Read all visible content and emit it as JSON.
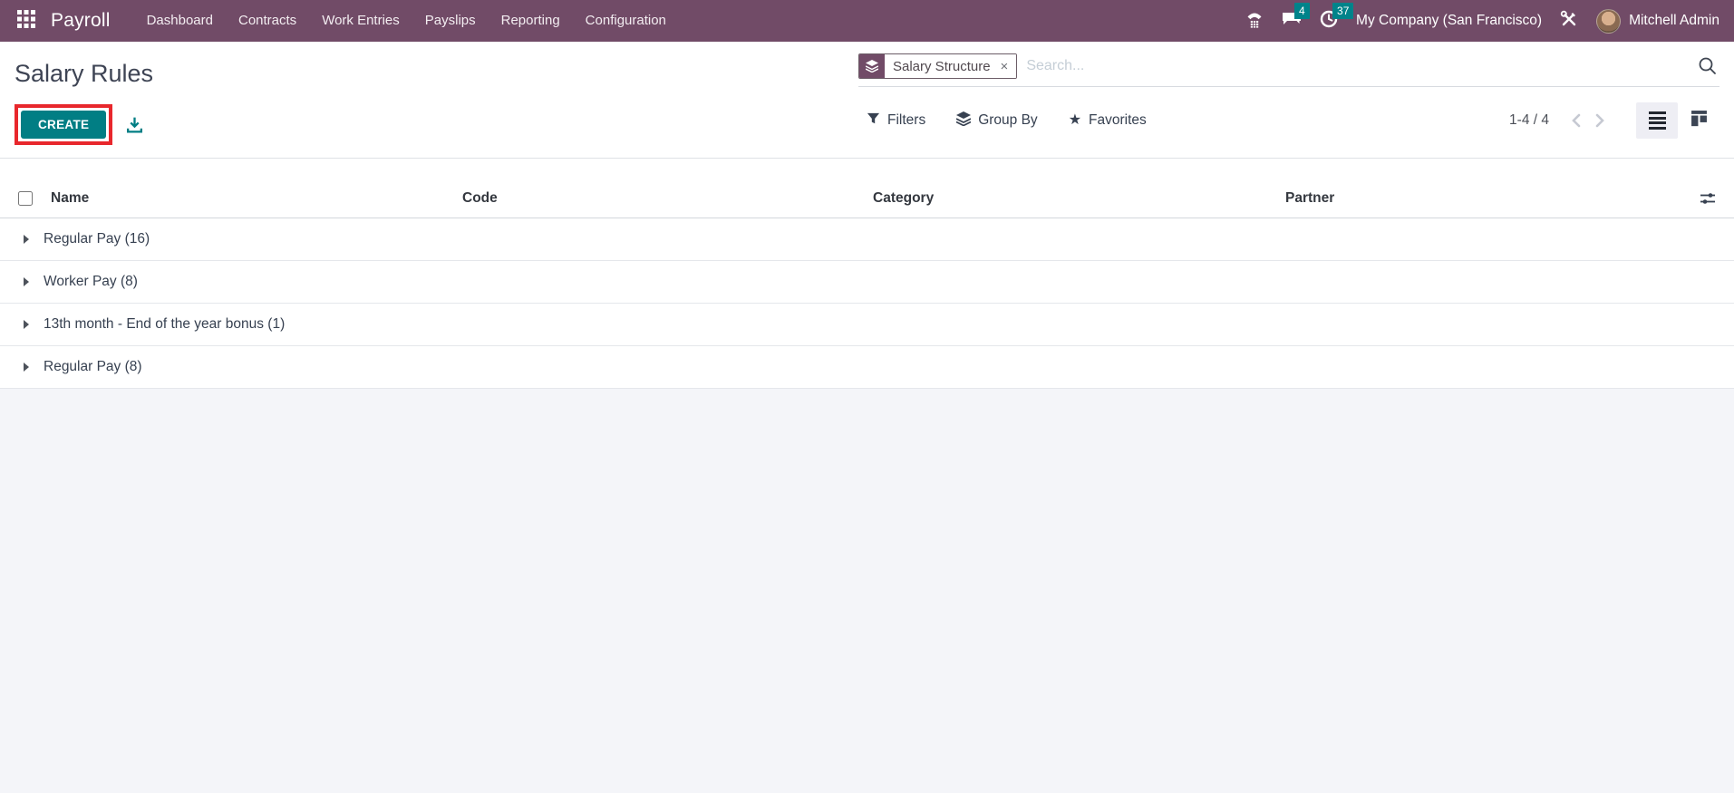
{
  "navbar": {
    "app_name": "Payroll",
    "menu_items": [
      "Dashboard",
      "Contracts",
      "Work Entries",
      "Payslips",
      "Reporting",
      "Configuration"
    ],
    "messages_badge": "4",
    "activities_badge": "37",
    "company_name": "My Company (San Francisco)",
    "user_name": "Mitchell Admin",
    "colors": {
      "background": "#714B67",
      "badge": "#00838A"
    }
  },
  "page": {
    "title": "Salary Rules"
  },
  "toolbar": {
    "create_label": "CREATE",
    "filters_label": "Filters",
    "group_by_label": "Group By",
    "favorites_label": "Favorites",
    "pager_text": "1-4 / 4",
    "accent_color": "#017E84",
    "highlight_color": "#E8272C"
  },
  "search": {
    "facet_label": "Salary Structure",
    "facet_remove": "×",
    "placeholder": "Search..."
  },
  "table": {
    "columns": [
      "Name",
      "Code",
      "Category",
      "Partner"
    ],
    "groups": [
      {
        "text": "Regular Pay (16)"
      },
      {
        "text": "Worker Pay (8)"
      },
      {
        "text": "13th month - End of the year bonus (1)"
      },
      {
        "text": "Regular Pay (8)"
      }
    ]
  }
}
